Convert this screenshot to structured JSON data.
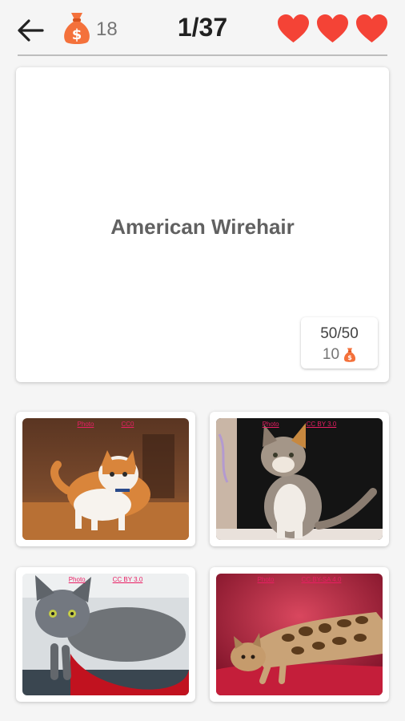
{
  "header": {
    "coins": "18",
    "progress": "1/37",
    "lives": 3
  },
  "question": {
    "breed": "American Wirehair",
    "score": "50/50",
    "reward": "10"
  },
  "answers": [
    {
      "subject": "orange-white-cat",
      "credit": "Photo",
      "license": "CC0"
    },
    {
      "subject": "calico-wirehair-cat",
      "credit": "Photo",
      "license": "CC BY 3.0"
    },
    {
      "subject": "grey-blue-cat",
      "credit": "Photo",
      "license": "CC BY 3.0"
    },
    {
      "subject": "bengal-cat",
      "credit": "Photo",
      "license": "CC BY-SA 4.0"
    }
  ],
  "colors": {
    "heart": "#f44336",
    "coin_bag": "#f4713b",
    "accent_link": "#e91e63"
  }
}
